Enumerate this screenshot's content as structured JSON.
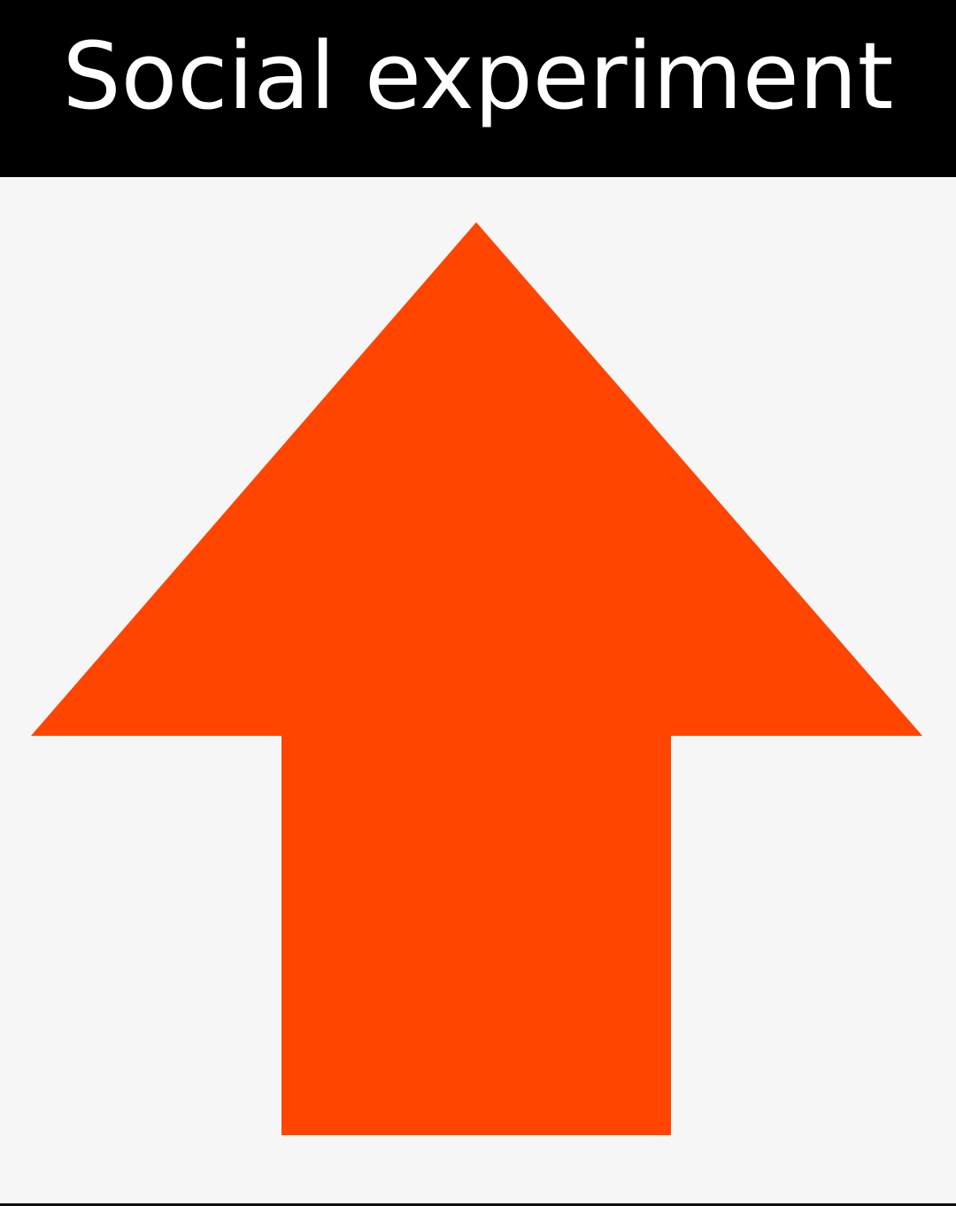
{
  "header": {
    "title": "Social experiment"
  },
  "arrow": {
    "icon": "upvote-arrow-icon",
    "color": "#ff4500",
    "direction": "up"
  },
  "colors": {
    "header_background": "#000000",
    "header_text": "#ffffff",
    "page_background": "#f6f6f6"
  }
}
